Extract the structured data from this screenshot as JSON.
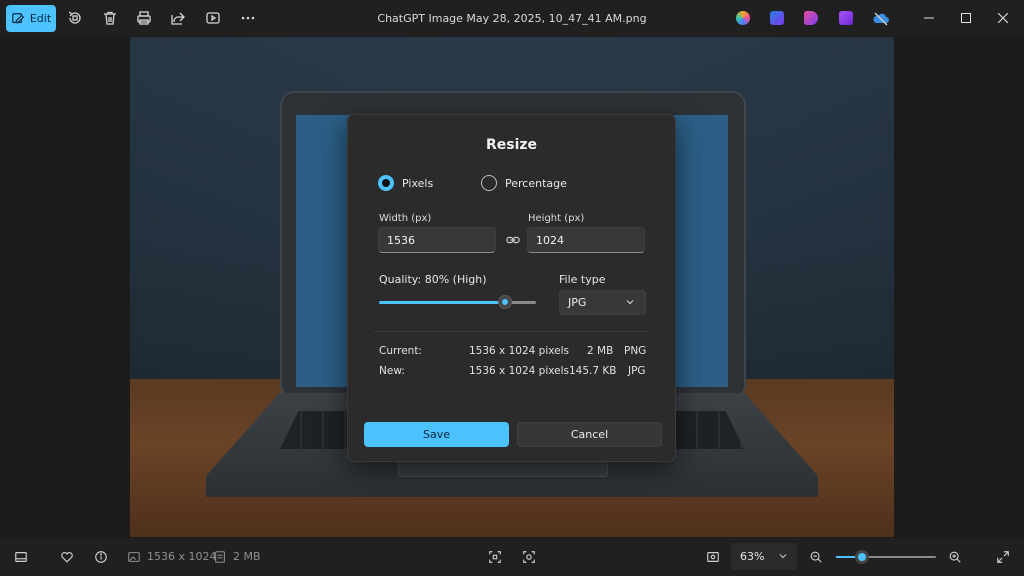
{
  "window": {
    "title": "ChatGPT Image May 28, 2025, 10_47_41 AM.png",
    "accent_color": "#4cc2ff"
  },
  "toolbar": {
    "edit_label": "Edit",
    "icons": [
      "edit-icon",
      "rotate-icon",
      "delete-icon",
      "print-icon",
      "share-icon",
      "slideshow-icon",
      "more-icon"
    ],
    "app_icons": [
      "copilot-icon",
      "designer-icon",
      "clipchamp-icon",
      "video-icon",
      "onedrive-icon"
    ],
    "window_controls": [
      "minimize-icon",
      "maximize-icon",
      "close-icon"
    ]
  },
  "dialog": {
    "title": "Resize",
    "mode_options": [
      {
        "label": "Pixels",
        "checked": true
      },
      {
        "label": "Percentage",
        "checked": false
      }
    ],
    "width_label": "Width  (px)",
    "width_value": "1536",
    "height_label": "Height  (px)",
    "height_value": "1024",
    "quality_label": "Quality: 80% (High)",
    "quality_value": 0.8,
    "file_type_label": "File type",
    "file_type_value": "JPG",
    "current": {
      "label": "Current:",
      "dimensions": "1536 x 1024 pixels",
      "size": "2 MB",
      "format": "PNG"
    },
    "new": {
      "label": "New:",
      "dimensions": "1536 x 1024 pixels",
      "size": "145.7 KB",
      "format": "JPG"
    },
    "save_label": "Save",
    "cancel_label": "Cancel"
  },
  "statusbar": {
    "dimensions": "1536 x 1024",
    "file_size": "2 MB",
    "zoom_label": "63%",
    "zoom_value": 0.63
  }
}
